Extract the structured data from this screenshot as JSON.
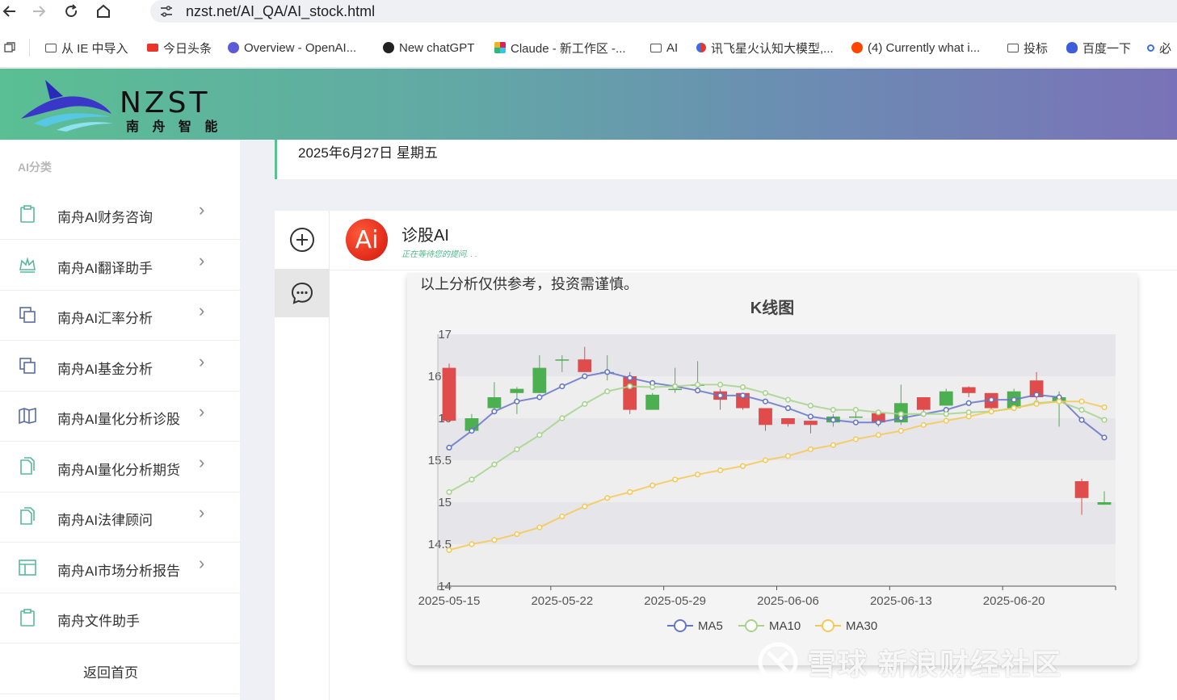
{
  "browser": {
    "url": "nzst.net/AI_QA/AI_stock.html",
    "bookmarks": [
      {
        "label": "从 IE 中导入",
        "icon": "folder-icon"
      },
      {
        "label": "今日头条",
        "icon": "toutiao-icon"
      },
      {
        "label": "Overview - OpenAI...",
        "icon": "openai-icon"
      },
      {
        "label": "New chatGPT",
        "icon": "chatgpt-icon"
      },
      {
        "label": "Claude - 新工作区 -...",
        "icon": "slack-icon"
      },
      {
        "label": "AI",
        "icon": "folder-icon"
      },
      {
        "label": "讯飞星火认知大模型,...",
        "icon": "xunfei-icon"
      },
      {
        "label": "(4) Currently what i...",
        "icon": "reddit-icon"
      },
      {
        "label": "投标",
        "icon": "folder-icon"
      },
      {
        "label": "百度一下",
        "icon": "baidu-icon"
      },
      {
        "label": "必",
        "icon": "search-icon"
      }
    ]
  },
  "header": {
    "logo_text": "NZST",
    "logo_subtitle": "南 舟 智 能"
  },
  "sidebar": {
    "title": "AI分类",
    "items": [
      {
        "label": "南舟AI财务咨询",
        "icon": "clipboard-icon"
      },
      {
        "label": "南舟AI翻译助手",
        "icon": "crown-icon"
      },
      {
        "label": "南舟AI汇率分析",
        "icon": "copy-icon"
      },
      {
        "label": "南舟AI基金分析",
        "icon": "copy-icon"
      },
      {
        "label": "南舟AI量化分析诊股",
        "icon": "book-icon"
      },
      {
        "label": "南舟AI量化分析期货",
        "icon": "file-copy-icon"
      },
      {
        "label": "南舟AI法律顾问",
        "icon": "file-copy-icon"
      },
      {
        "label": "南舟AI市场分析报告",
        "icon": "layout-icon"
      },
      {
        "label": "南舟文件助手",
        "icon": "clipboard-icon"
      }
    ],
    "back_home": "返回首页"
  },
  "date": "2025年6月27日 星期五",
  "chat": {
    "ai_name": "诊股AI",
    "ai_avatar": "Ai",
    "status": "正在等待您的提问. . .",
    "message": "以上分析仅供参考，投资需谨慎。"
  },
  "watermark": "雪球 新浪财经社区",
  "colors": {
    "up": "#e04b4b",
    "down": "#4caf50",
    "ma5": "#6675c8",
    "ma10": "#a6d48c",
    "ma30": "#f6c855"
  },
  "chart_data": {
    "type": "candlestick",
    "title": "K线图",
    "xlabel": "",
    "ylabel": "",
    "ylim": [
      14,
      17
    ],
    "yticks": [
      14,
      14.5,
      15,
      15.5,
      16,
      16.5,
      17
    ],
    "xtick_labels": [
      "2025-05-15",
      "2025-05-22",
      "2025-05-29",
      "2025-06-06",
      "2025-06-13",
      "2025-06-20"
    ],
    "xtick_index": [
      0,
      5,
      10,
      15,
      20,
      25
    ],
    "candles": [
      [
        16.6,
        15.97,
        16.65,
        15.95
      ],
      [
        15.85,
        16.0,
        16.05,
        15.82
      ],
      [
        16.12,
        16.25,
        16.43,
        16.1
      ],
      [
        16.3,
        16.35,
        16.37,
        16.05
      ],
      [
        16.3,
        16.6,
        16.75,
        16.3
      ],
      [
        16.7,
        16.7,
        16.75,
        16.55
      ],
      [
        16.7,
        16.55,
        16.85,
        16.55
      ],
      [
        16.55,
        16.55,
        16.75,
        16.45
      ],
      [
        16.5,
        16.1,
        16.55,
        16.05
      ],
      [
        16.1,
        16.28,
        16.3,
        16.1
      ],
      [
        16.35,
        16.35,
        16.6,
        16.3
      ],
      [
        16.4,
        16.4,
        16.68,
        16.35
      ],
      [
        16.32,
        16.22,
        16.35,
        16.1
      ],
      [
        16.3,
        16.12,
        16.3,
        16.1
      ],
      [
        16.12,
        15.92,
        16.12,
        15.85
      ],
      [
        16.0,
        15.93,
        16.0,
        15.9
      ],
      [
        15.97,
        15.92,
        15.97,
        15.82
      ],
      [
        15.95,
        16.02,
        16.05,
        15.9
      ],
      [
        16.02,
        16.02,
        16.1,
        16.0
      ],
      [
        16.06,
        15.95,
        16.1,
        15.9
      ],
      [
        15.95,
        16.18,
        16.4,
        15.92
      ],
      [
        16.25,
        16.1,
        16.25,
        16.08
      ],
      [
        16.15,
        16.32,
        16.35,
        16.15
      ],
      [
        16.37,
        16.3,
        16.38,
        16.25
      ],
      [
        16.3,
        16.12,
        16.3,
        16.1
      ],
      [
        16.12,
        16.32,
        16.35,
        16.1
      ],
      [
        16.45,
        16.25,
        16.55,
        16.22
      ],
      [
        16.2,
        16.25,
        16.32,
        15.9
      ],
      [
        15.25,
        15.05,
        15.28,
        14.85
      ],
      [
        14.97,
        15.0,
        15.13,
        14.97
      ]
    ],
    "series": [
      {
        "name": "MA5",
        "values": [
          15.65,
          15.85,
          16.08,
          16.2,
          16.25,
          16.38,
          16.5,
          16.55,
          16.48,
          16.42,
          16.38,
          16.33,
          16.27,
          16.27,
          16.2,
          16.12,
          16.02,
          15.98,
          15.95,
          15.95,
          16.0,
          16.05,
          16.1,
          16.18,
          16.22,
          16.22,
          16.28,
          16.25,
          15.98,
          15.77
        ]
      },
      {
        "name": "MA10",
        "values": [
          15.12,
          15.27,
          15.45,
          15.63,
          15.8,
          16.0,
          16.17,
          16.32,
          16.38,
          16.37,
          16.38,
          16.4,
          16.4,
          16.37,
          16.3,
          16.22,
          16.15,
          16.1,
          16.1,
          16.07,
          16.05,
          16.05,
          16.05,
          16.07,
          16.08,
          16.12,
          16.18,
          16.2,
          16.1,
          15.98
        ]
      },
      {
        "name": "MA30",
        "values": [
          14.43,
          14.5,
          14.55,
          14.62,
          14.7,
          14.83,
          14.95,
          15.05,
          15.12,
          15.2,
          15.27,
          15.33,
          15.38,
          15.43,
          15.5,
          15.55,
          15.63,
          15.68,
          15.75,
          15.8,
          15.85,
          15.92,
          15.97,
          16.02,
          16.08,
          16.12,
          16.17,
          16.2,
          16.2,
          16.13
        ]
      }
    ]
  }
}
